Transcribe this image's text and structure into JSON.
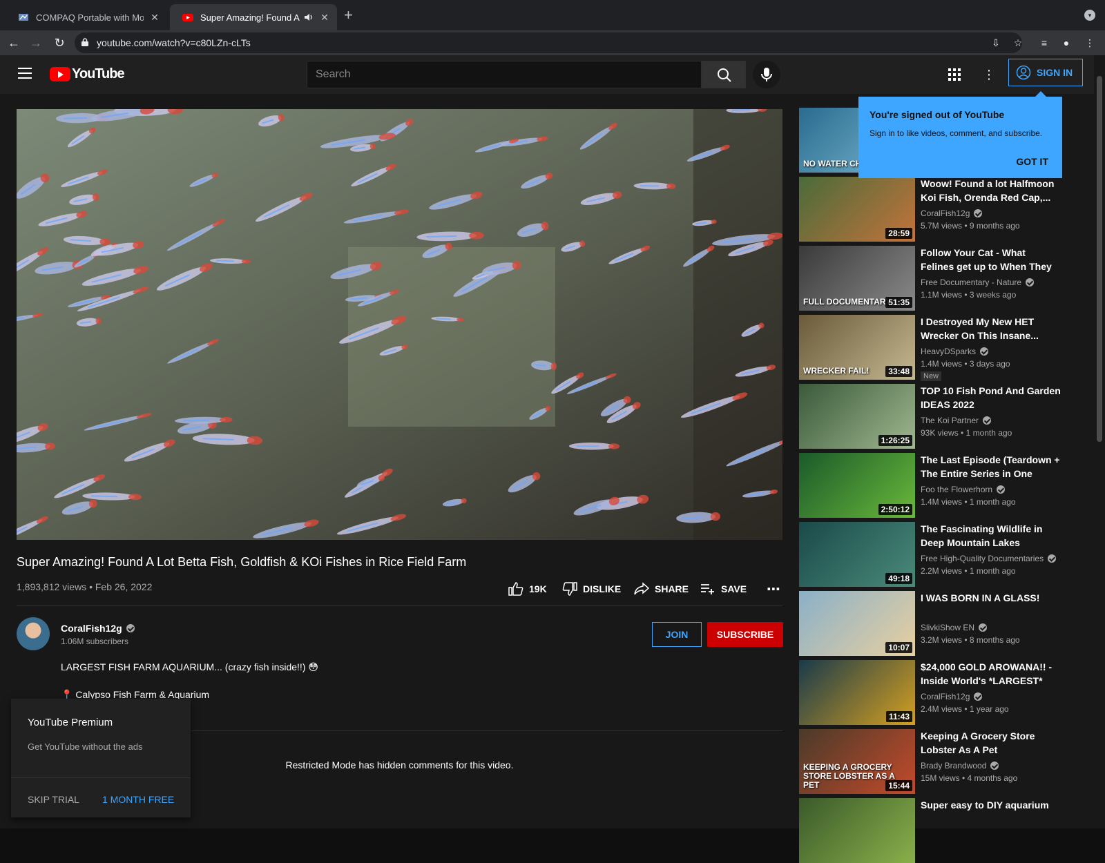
{
  "browser": {
    "tabs": [
      {
        "title": "COMPAQ Portable with Monoc"
      },
      {
        "title": "Super Amazing! Found A Lot"
      }
    ],
    "url": "youtube.com/watch?v=c80LZn-cLTs"
  },
  "header": {
    "logo_text": "YouTube",
    "search_placeholder": "Search",
    "sign_in": "SIGN IN"
  },
  "video": {
    "title": "Super Amazing! Found A Lot Betta Fish, Goldfish & KOi Fishes in Rice Field Farm",
    "views_date": "1,893,812 views • Feb 26, 2022",
    "likes": "19K",
    "dislike": "DISLIKE",
    "share": "SHARE",
    "save": "SAVE"
  },
  "channel": {
    "name": "CoralFish12g",
    "subscribers": "1.06M subscribers",
    "join": "JOIN",
    "subscribe": "SUBSCRIBE"
  },
  "description": {
    "line1": "LARGEST FISH FARM AQUARIUM... (crazy fish inside!!) 😳",
    "line2": "📍 Calypso Fish Farm & Aquarium"
  },
  "comments": {
    "restricted": "Restricted Mode has hidden comments for this video."
  },
  "premium": {
    "title": "YouTube Premium",
    "subtitle": "Get YouTube without the ads",
    "skip": "SKIP TRIAL",
    "free": "1 MONTH FREE"
  },
  "tooltip": {
    "title": "You're signed out of YouTube",
    "body": "Sign in to like videos, comment, and subscribe.",
    "button": "GOT IT"
  },
  "recommendations": [
    {
      "title": "",
      "channel": "",
      "meta": "",
      "duration": "",
      "thumb_text": "NO WATER CHANGES"
    },
    {
      "title": "Woow! Found a lot Halfmoon Koi Fish, Orenda Red Cap,...",
      "channel": "CoralFish12g",
      "meta": "5.7M views • 9 months ago",
      "duration": "28:59"
    },
    {
      "title": "Follow Your Cat - What Felines get up to When They Leave the...",
      "channel": "Free Documentary - Nature",
      "meta": "1.1M views • 3 weeks ago",
      "duration": "51:35",
      "thumb_text": "FULL DOCUMENTARY"
    },
    {
      "title": "I Destroyed My New HET Wrecker On This Insane...",
      "channel": "HeavyDSparks",
      "meta": "1.4M views • 3 days ago",
      "duration": "33:48",
      "badge": "New",
      "thumb_text": "WRECKER FAIL!"
    },
    {
      "title": "TOP 10 Fish Pond And Garden IDEAS 2022",
      "channel": "The Koi Partner",
      "meta": "93K views • 1 month ago",
      "duration": "1:26:25"
    },
    {
      "title": "The Last Episode (Teardown + The Entire Series in One Video)",
      "channel": "Foo the Flowerhorn",
      "meta": "1.4M views • 1 month ago",
      "duration": "2:50:12"
    },
    {
      "title": "The Fascinating Wildlife in Deep Mountain Lakes",
      "channel": "Free High-Quality Documentaries",
      "meta": "2.2M views • 1 month ago",
      "duration": "49:18"
    },
    {
      "title": "I WAS BORN IN A GLASS!",
      "channel": "SlivkiShow EN",
      "meta": "3.2M views • 8 months ago",
      "duration": "10:07"
    },
    {
      "title": "$24,000 GOLD AROWANA!! - Inside World's *LARGEST* Rar...",
      "channel": "CoralFish12g",
      "meta": "2.4M views • 1 year ago",
      "duration": "11:43"
    },
    {
      "title": "Keeping A Grocery Store Lobster As A Pet",
      "channel": "Brady Brandwood",
      "meta": "15M views • 4 months ago",
      "duration": "15:44",
      "thumb_text": "KEEPING A GROCERY STORE LOBSTER AS A PET"
    },
    {
      "title": "Super easy to DIY aquarium",
      "channel": "",
      "meta": "",
      "duration": ""
    }
  ]
}
